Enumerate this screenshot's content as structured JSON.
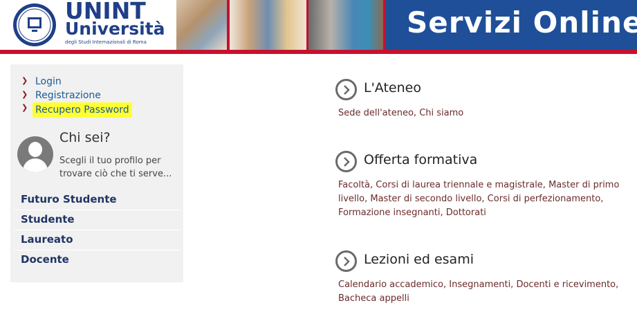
{
  "header": {
    "logo_brand": "UNINT",
    "logo_name": "Università",
    "logo_subtitle": "degli Studi Internazionali di Roma",
    "banner_title": "Servizi Online"
  },
  "sidebar": {
    "links": [
      {
        "label": "Login",
        "icon": "chevron-right-icon"
      },
      {
        "label": "Registrazione",
        "icon": "chevron-right-icon"
      },
      {
        "label": "Recupero Password",
        "icon": "chevron-right-icon",
        "highlighted": true
      }
    ],
    "who": {
      "title": "Chi sei?",
      "description": "Scegli il tuo profilo per trovare ciò che ti serve..."
    },
    "profiles": [
      {
        "label": "Futuro Studente"
      },
      {
        "label": "Studente"
      },
      {
        "label": "Laureato"
      },
      {
        "label": "Docente"
      }
    ]
  },
  "main": {
    "sections": [
      {
        "title": "L'Ateneo",
        "description": "Sede dell'ateneo, Chi siamo"
      },
      {
        "title": "Offerta formativa",
        "description": "Facoltà, Corsi di laurea triennale e magistrale, Master di primo livello, Master di secondo livello, Corsi di perfezionamento, Formazione insegnanti, Dottorati"
      },
      {
        "title": "Lezioni ed esami",
        "description": "Calendario accademico, Insegnamenti, Docenti e ricevimento, Bacheca appelli"
      }
    ]
  },
  "colors": {
    "brand_blue": "#1f4f98",
    "accent_red": "#c8102e",
    "highlight": "#ffff33"
  }
}
